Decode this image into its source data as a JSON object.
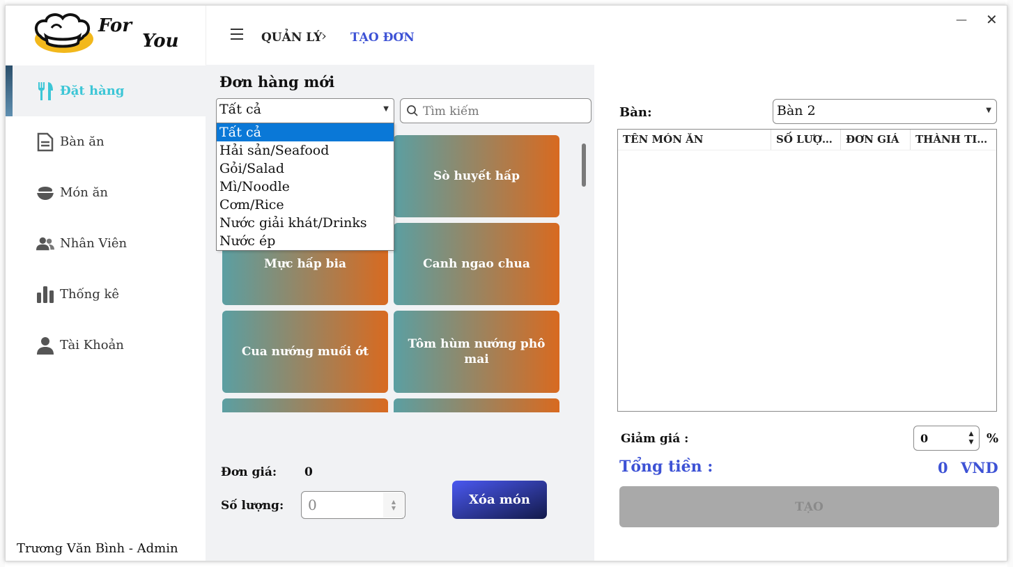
{
  "app": {
    "logo": {
      "line1": "For",
      "line2": "You"
    },
    "user": "Trương Văn Bình - Admin"
  },
  "sidebar": {
    "items": [
      {
        "label": "Đặt hàng",
        "icon": "utensils-icon",
        "active": true
      },
      {
        "label": "Bàn ăn",
        "icon": "document-icon",
        "active": false
      },
      {
        "label": "Món ăn",
        "icon": "bowl-icon",
        "active": false
      },
      {
        "label": "Nhân Viên",
        "icon": "users-icon",
        "active": false
      },
      {
        "label": "Thống kê",
        "icon": "bar-chart-icon",
        "active": false
      },
      {
        "label": "Tài Khoản",
        "icon": "user-icon",
        "active": false
      }
    ]
  },
  "header": {
    "breadcrumb_root": "QUẢN LÝ",
    "breadcrumb_current": "TẠO ĐƠN",
    "minimize": "—",
    "close": "✕"
  },
  "order": {
    "title": "Đơn hàng mới",
    "category_selected": "Tất cả",
    "category_options": [
      "Tất cả",
      "Hải sản/Seafood",
      "Gỏi/Salad",
      "Mì/Noodle",
      "Cơm/Rice",
      "Nước giải khát/Drinks",
      "Nước ép"
    ],
    "search_placeholder": "Tìm kiếm",
    "dishes": [
      "",
      "Sò huyết hấp",
      "Mực hấp bia",
      "Canh ngao chua",
      "Cua nướng muối ớt",
      "Tôm hùm nướng phô mai",
      "",
      ""
    ],
    "price_label": "Đơn giá:",
    "price_value": "0",
    "quantity_label": "Số lượng:",
    "quantity_value": "0",
    "delete_button": "Xóa món"
  },
  "bill": {
    "table_label": "Bàn:",
    "table_selected": "Bàn 2",
    "columns": [
      "TÊN MÓN ĂN",
      "SỐ LƯỢNG",
      "ĐƠN GIÁ",
      "THÀNH TIỀN"
    ],
    "rows": [],
    "discount_label": "Giảm giá :",
    "discount_value": "0",
    "discount_unit": "%",
    "total_label": "Tổng tiền :",
    "total_value": "0",
    "total_unit": "VND",
    "create_button": "TẠO"
  },
  "colors": {
    "accent": "#3d52d5",
    "active_nav": "#3dc6d6",
    "tile_start": "#5b9fa2",
    "tile_end": "#d86a20",
    "selected_option": "#0a78d7"
  }
}
